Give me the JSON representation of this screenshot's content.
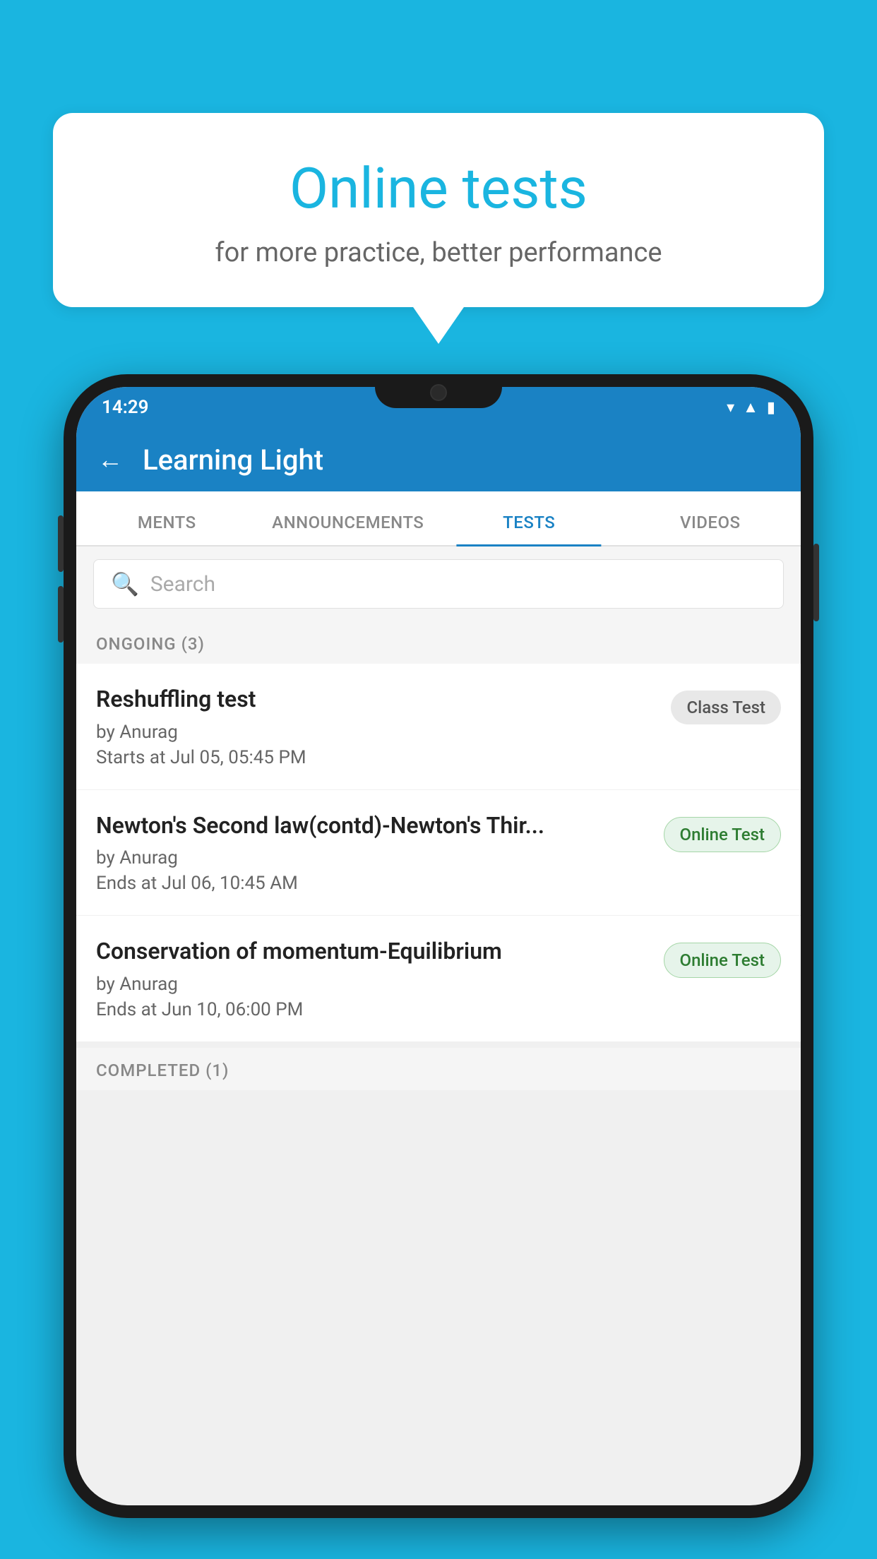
{
  "background_color": "#1ab5e0",
  "bubble": {
    "title": "Online tests",
    "subtitle": "for more practice, better performance"
  },
  "phone": {
    "status_bar": {
      "time": "14:29",
      "icons": [
        "wifi",
        "signal",
        "battery"
      ]
    },
    "header": {
      "title": "Learning Light",
      "back_label": "←"
    },
    "tabs": [
      {
        "label": "MENTS",
        "active": false
      },
      {
        "label": "ANNOUNCEMENTS",
        "active": false
      },
      {
        "label": "TESTS",
        "active": true
      },
      {
        "label": "VIDEOS",
        "active": false
      }
    ],
    "search": {
      "placeholder": "Search"
    },
    "sections": {
      "ongoing": {
        "label": "ONGOING (3)",
        "tests": [
          {
            "title": "Reshuffling test",
            "author": "by Anurag",
            "time": "Starts at  Jul 05, 05:45 PM",
            "badge": "Class Test",
            "badge_type": "class"
          },
          {
            "title": "Newton's Second law(contd)-Newton's Thir...",
            "author": "by Anurag",
            "time": "Ends at  Jul 06, 10:45 AM",
            "badge": "Online Test",
            "badge_type": "online"
          },
          {
            "title": "Conservation of momentum-Equilibrium",
            "author": "by Anurag",
            "time": "Ends at  Jun 10, 06:00 PM",
            "badge": "Online Test",
            "badge_type": "online"
          }
        ]
      },
      "completed": {
        "label": "COMPLETED (1)"
      }
    }
  }
}
